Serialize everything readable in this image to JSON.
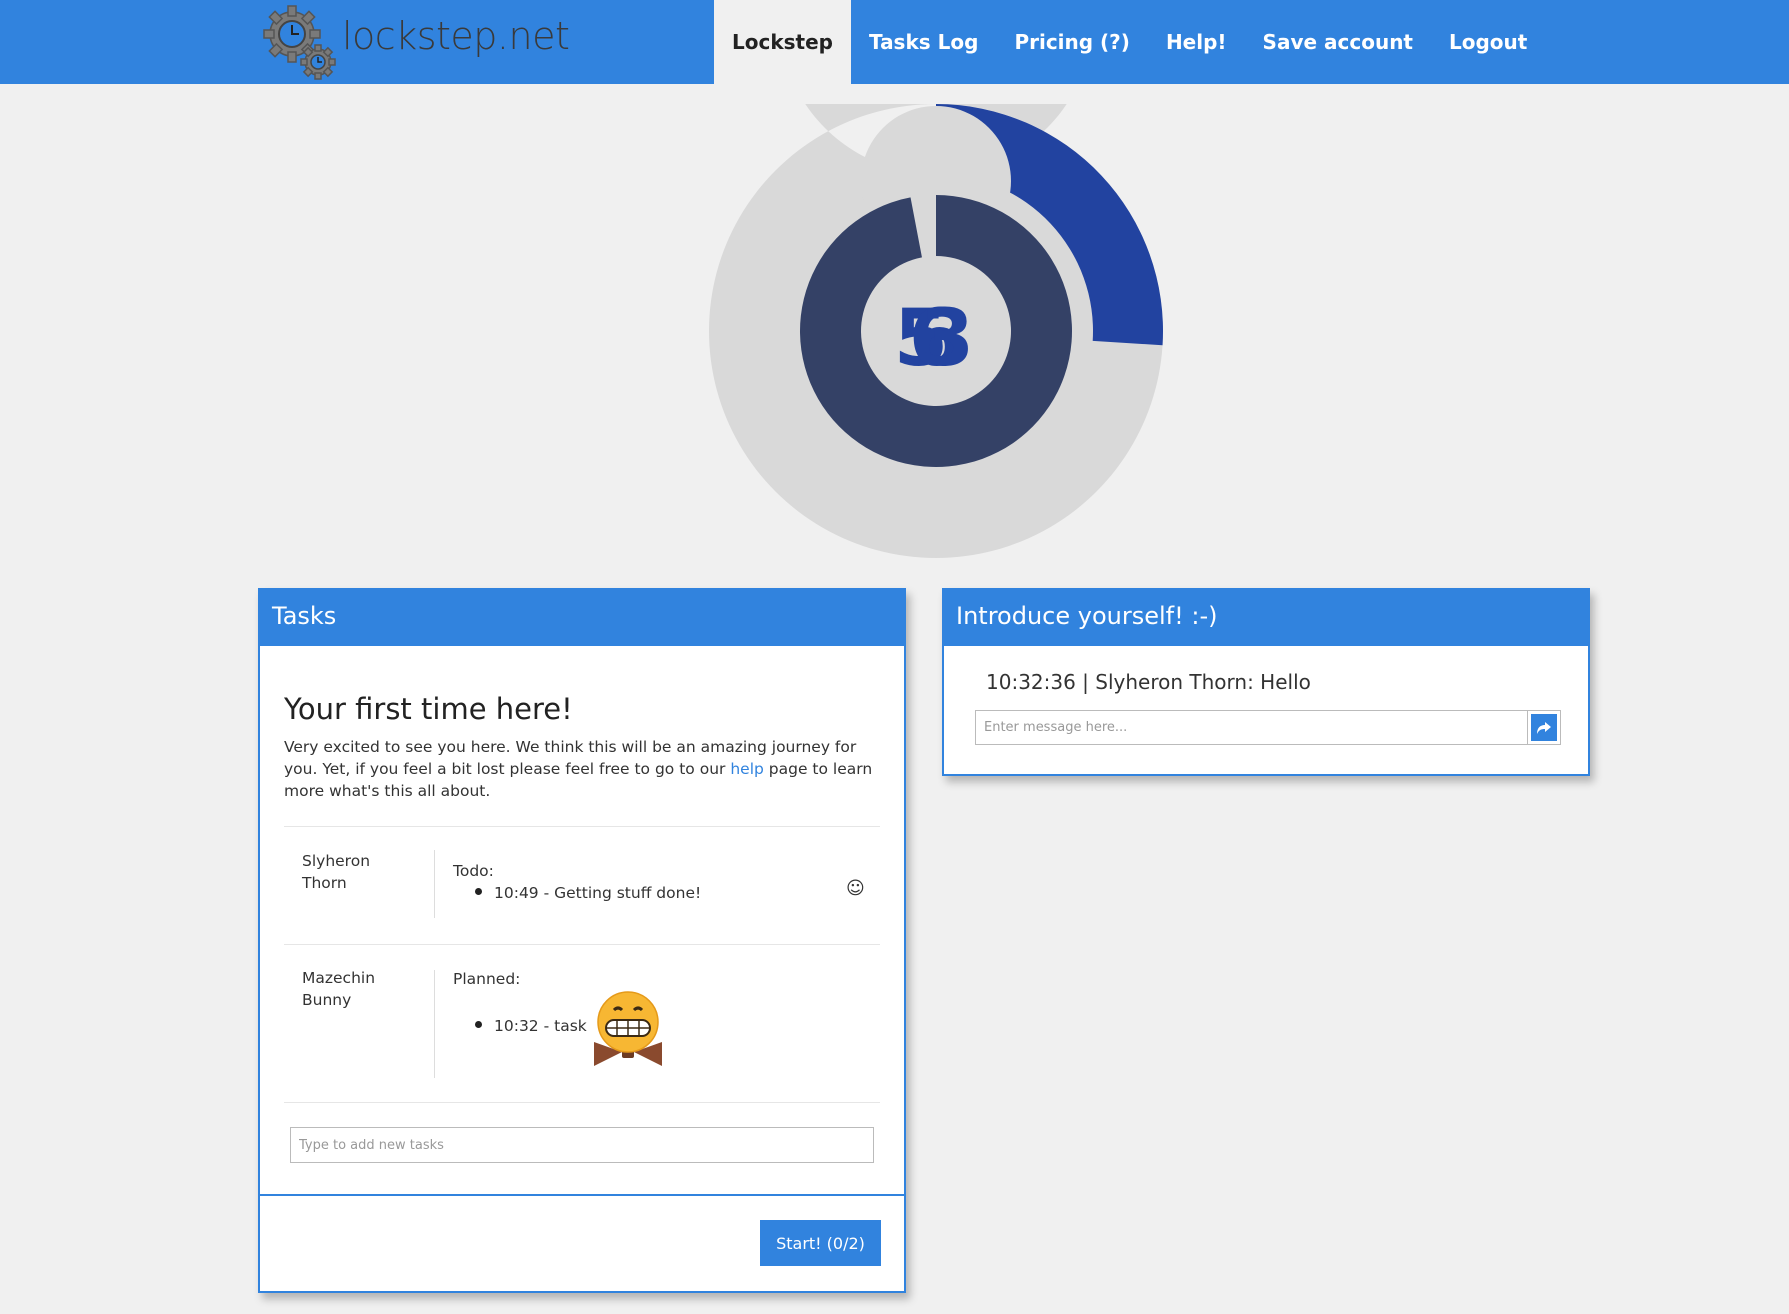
{
  "brand": {
    "name": "lockstep.net"
  },
  "nav": {
    "items": [
      {
        "label": "Lockstep",
        "active": true
      },
      {
        "label": "Tasks Log",
        "active": false
      },
      {
        "label": "Pricing (?)",
        "active": false
      },
      {
        "label": "Help!",
        "active": false
      },
      {
        "label": "Save account",
        "active": false
      },
      {
        "label": "Logout",
        "active": false
      }
    ]
  },
  "timer": {
    "minutes_progress": 0.26,
    "seconds_progress": 0.97,
    "display_digits": [
      "5",
      "6",
      "3"
    ],
    "colors": {
      "outer_track": "#d9d9d9",
      "outer_fill": "#2243a0",
      "inner_fill": "#344166",
      "inner_gap": "#d9d9d9",
      "digits": "#2243a0"
    }
  },
  "tasks_panel": {
    "title": "Tasks",
    "welcome_title": "Your first time here!",
    "welcome_text_before": "Very excited to see you here. We think this will be an amazing journey for you. Yet, if you feel a bit lost please feel free to go to our ",
    "welcome_link": "help",
    "welcome_text_after": " page to learn more what's this all about.",
    "users": [
      {
        "name": "Slyheron Thorn",
        "status_label": "Todo:",
        "tasks": [
          {
            "time": "10:49",
            "text": "10:49 - Getting stuff done!"
          }
        ],
        "icon": "smile-icon"
      },
      {
        "name": "Mazechin Bunny",
        "status_label": "Planned:",
        "tasks": [
          {
            "time": "10:32",
            "text": "10:32 - task"
          }
        ],
        "icon": "grimacing-bowtie-emoji"
      }
    ],
    "add_task_placeholder": "Type to add new tasks",
    "start_button": "Start! (0/2)"
  },
  "intro_panel": {
    "title": "Introduce yourself! :-)",
    "messages": [
      {
        "text": "10:32:36 | Slyheron Thorn: Hello"
      }
    ],
    "message_placeholder": "Enter message here...",
    "send_icon": "reply-arrow-icon"
  },
  "colors": {
    "accent": "#3183de",
    "background": "#f0f0f0"
  }
}
